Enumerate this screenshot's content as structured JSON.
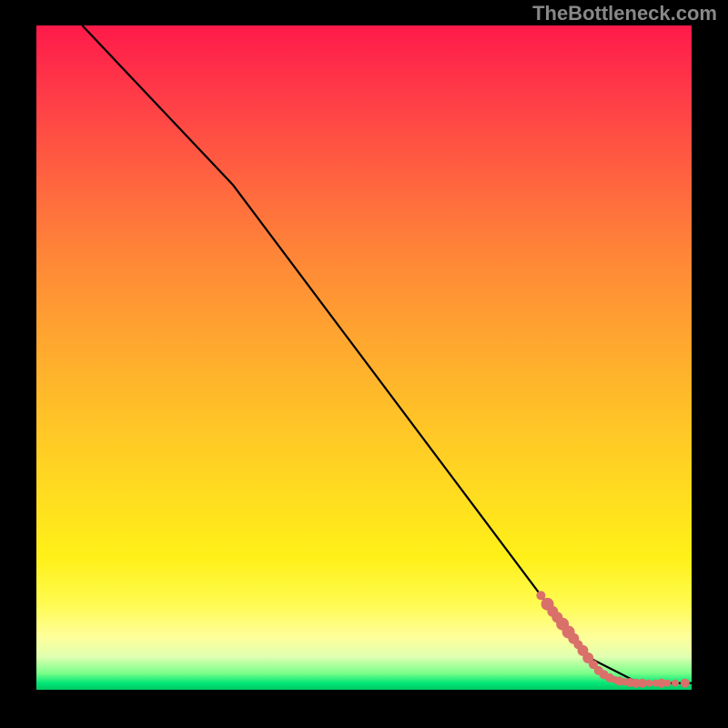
{
  "watermark": "TheBottleneck.com",
  "chart_data": {
    "type": "line",
    "title": "",
    "xlabel": "",
    "ylabel": "",
    "xlim": [
      0,
      100
    ],
    "ylim": [
      0,
      100
    ],
    "grid": false,
    "legend": false,
    "series": [
      {
        "name": "curve",
        "x": [
          7,
          30,
          84,
          92,
          100
        ],
        "y": [
          100,
          76,
          5,
          1,
          1
        ]
      }
    ],
    "scatter": {
      "name": "points",
      "color": "#d9706a",
      "points": [
        {
          "x": 77,
          "y": 14.2,
          "r": 5
        },
        {
          "x": 78,
          "y": 12.9,
          "r": 7
        },
        {
          "x": 78.8,
          "y": 11.8,
          "r": 6
        },
        {
          "x": 79.5,
          "y": 10.9,
          "r": 6
        },
        {
          "x": 80.3,
          "y": 9.9,
          "r": 7
        },
        {
          "x": 81.2,
          "y": 8.7,
          "r": 7
        },
        {
          "x": 82,
          "y": 7.7,
          "r": 6
        },
        {
          "x": 82.7,
          "y": 6.8,
          "r": 5
        },
        {
          "x": 83.4,
          "y": 5.9,
          "r": 6
        },
        {
          "x": 84.2,
          "y": 4.8,
          "r": 6
        },
        {
          "x": 85,
          "y": 3.8,
          "r": 5
        },
        {
          "x": 85.8,
          "y": 2.9,
          "r": 5
        },
        {
          "x": 86.6,
          "y": 2.3,
          "r": 5
        },
        {
          "x": 87.5,
          "y": 1.8,
          "r": 5
        },
        {
          "x": 88.3,
          "y": 1.5,
          "r": 4
        },
        {
          "x": 89,
          "y": 1.3,
          "r": 5
        },
        {
          "x": 89.8,
          "y": 1.2,
          "r": 4
        },
        {
          "x": 90.6,
          "y": 1.1,
          "r": 5
        },
        {
          "x": 91.5,
          "y": 1.0,
          "r": 5
        },
        {
          "x": 92.5,
          "y": 1.0,
          "r": 5
        },
        {
          "x": 93.5,
          "y": 1.0,
          "r": 4
        },
        {
          "x": 94.5,
          "y": 1.0,
          "r": 4
        },
        {
          "x": 95.4,
          "y": 1.0,
          "r": 5
        },
        {
          "x": 96.3,
          "y": 1.0,
          "r": 4
        },
        {
          "x": 97.5,
          "y": 1.0,
          "r": 4
        },
        {
          "x": 99.0,
          "y": 1.0,
          "r": 5
        }
      ]
    },
    "background": {
      "type": "vertical-gradient",
      "stops": [
        {
          "pos": 0,
          "color": "#ff1a4a"
        },
        {
          "pos": 50,
          "color": "#ffb030"
        },
        {
          "pos": 80,
          "color": "#fff018"
        },
        {
          "pos": 95,
          "color": "#e0ffb0"
        },
        {
          "pos": 100,
          "color": "#00c864"
        }
      ]
    }
  }
}
